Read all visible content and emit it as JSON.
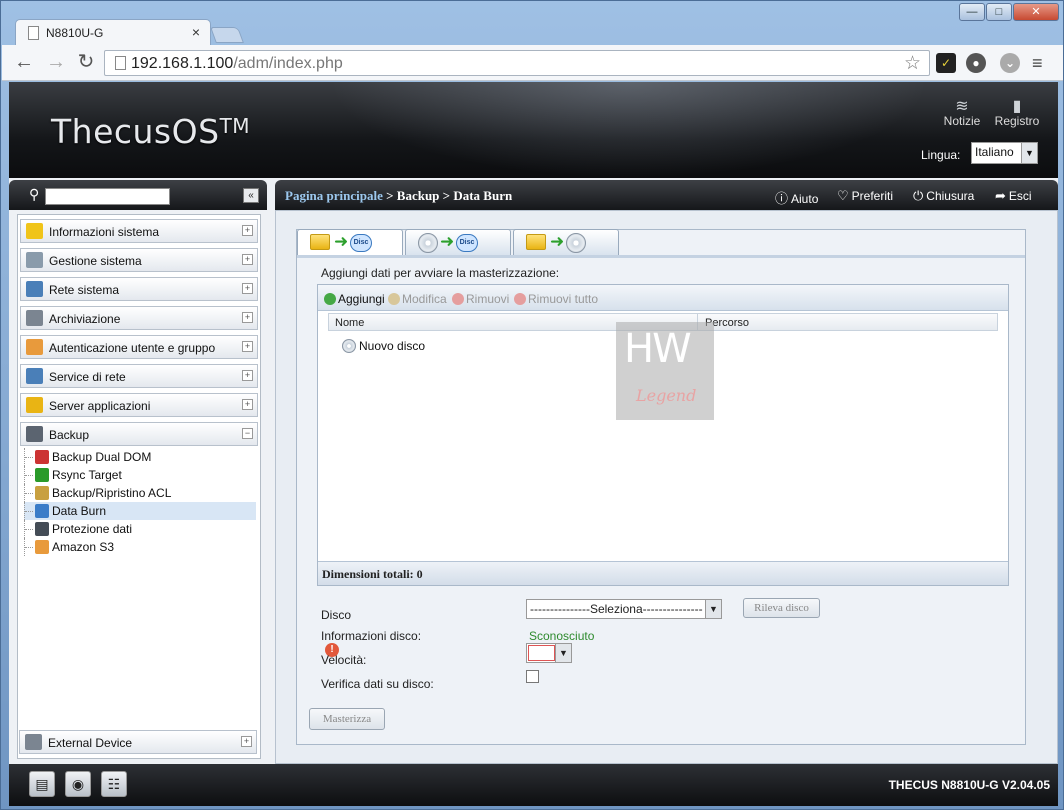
{
  "browser": {
    "tab_title": "N8810U-G",
    "tab_close": "×",
    "url_host": "192.168.1.100",
    "url_path": "/adm/index.php"
  },
  "header": {
    "brand": "ThecusOS",
    "brand_tm": "TM",
    "notizie": "Notizie",
    "registro": "Registro",
    "lingua_label": "Lingua:",
    "lingua_value": "Italiano"
  },
  "sidebar": {
    "menu": [
      {
        "label": "Informazioni sistema",
        "icon": "info-icon",
        "color": "#f0c419",
        "expander": "+"
      },
      {
        "label": "Gestione sistema",
        "icon": "tools-icon",
        "color": "#8a9bab",
        "expander": "+"
      },
      {
        "label": "Rete sistema",
        "icon": "network-icon",
        "color": "#4a7fb8",
        "expander": "+"
      },
      {
        "label": "Archiviazione",
        "icon": "storage-icon",
        "color": "#7b8591",
        "expander": "+"
      },
      {
        "label": "Autenticazione utente e gruppo",
        "icon": "users-icon",
        "color": "#e89a3c",
        "expander": "+"
      },
      {
        "label": "Service di rete",
        "icon": "service-icon",
        "color": "#4a7fb8",
        "expander": "+"
      },
      {
        "label": "Server applicazioni",
        "icon": "app-server-icon",
        "color": "#e9b414",
        "expander": "+"
      },
      {
        "label": "Backup",
        "icon": "backup-icon",
        "color": "#5b6470",
        "expander": "−"
      }
    ],
    "backup_items": [
      {
        "label": "Backup Dual DOM",
        "icon": "dual-dom-icon",
        "color": "#cc3333"
      },
      {
        "label": "Rsync Target",
        "icon": "rsync-icon",
        "color": "#2a9a2a"
      },
      {
        "label": "Backup/Ripristino ACL",
        "icon": "acl-icon",
        "color": "#c8a040"
      },
      {
        "label": "Data Burn",
        "icon": "data-burn-icon",
        "color": "#3a7cc8"
      },
      {
        "label": "Protezione dati",
        "icon": "data-protection-icon",
        "color": "#444c56"
      },
      {
        "label": "Amazon S3",
        "icon": "amazon-s3-icon",
        "color": "#e89a3c"
      }
    ],
    "external": {
      "label": "External Device",
      "expander": "+"
    }
  },
  "content_bar": {
    "home": "Pagina principale",
    "path": " > Backup > Data Burn",
    "aiuto": "Aiuto",
    "preferiti": "Preferiti",
    "chiusura": "Chiusura",
    "esci": "Esci"
  },
  "burn": {
    "instruction": "Aggiungi dati per avviare la masterizzazione:",
    "toolbar": {
      "add": "Aggiungi",
      "edit": "Modifica",
      "remove": "Rimuovi",
      "remove_all": "Rimuovi tutto"
    },
    "columns": {
      "name": "Nome",
      "path": "Percorso"
    },
    "row": "Nuovo disco",
    "total": "Dimensioni totali: 0",
    "disc_tab_label": "Disc",
    "watermark": {
      "line1": "HW",
      "line2": "Legend"
    }
  },
  "form": {
    "disco_label": "Disco",
    "disco_value": "---------------Seleziona---------------",
    "rileva_button": "Rileva disco",
    "info_label": "Informazioni disco:",
    "info_value": "Sconosciuto",
    "velocita_label": "Velocità:",
    "verifica_label": "Verifica dati su disco:",
    "masterizza_button": "Masterizza"
  },
  "footer": {
    "version": "THECUS N8810U-G V2.04.05"
  }
}
